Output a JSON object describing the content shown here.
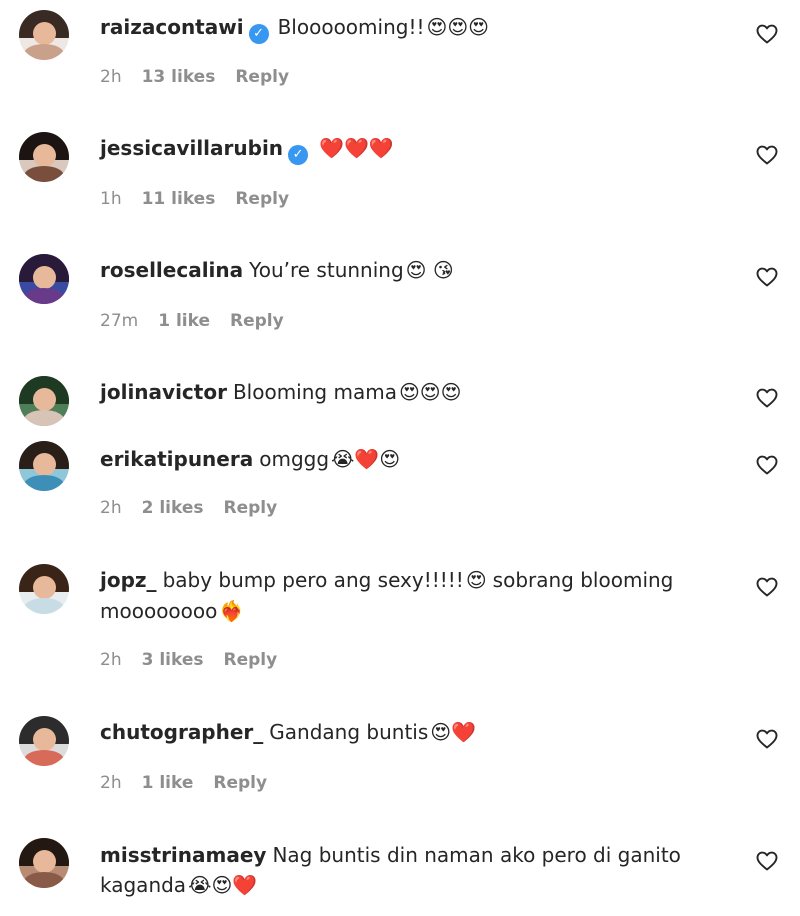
{
  "comments": [
    {
      "username": "raizacontawi",
      "verified": true,
      "text": "Bloooooming!!",
      "emojis": "😍😍😍",
      "text2": "",
      "emojis2": "",
      "time": "2h",
      "likes": "13 likes",
      "reply": "Reply",
      "avatar": {
        "hair": "#3a2a24",
        "body": "#c9a08a",
        "bg": "#efe7e2"
      }
    },
    {
      "username": "jessicavillarubin",
      "verified": true,
      "text": "",
      "emojis": "❤️❤️❤️",
      "text2": "",
      "emojis2": "",
      "time": "1h",
      "likes": "11 likes",
      "reply": "Reply",
      "avatar": {
        "hair": "#1c1412",
        "body": "#7a4e3c",
        "bg": "#d9c8be"
      }
    },
    {
      "username": "rosellecalina",
      "verified": false,
      "text": "You’re stunning",
      "emojis": "😍 😘",
      "text2": "",
      "emojis2": "",
      "time": "27m",
      "likes": "1 like",
      "reply": "Reply",
      "avatar": {
        "hair": "#2a1a3a",
        "body": "#6a3a8a",
        "bg": "#3a4aa0"
      }
    },
    {
      "username": "jolinavictor",
      "verified": false,
      "text": "Blooming mama",
      "emojis": "😍😍😍",
      "text2": "",
      "emojis2": "",
      "time": "",
      "likes": "",
      "reply": "",
      "avatar": {
        "hair": "#1f3a22",
        "body": "#d8c4b6",
        "bg": "#4f7f58"
      }
    },
    {
      "username": "erikatipunera",
      "verified": false,
      "text": "omggg",
      "emojis": "😭❤️😍",
      "text2": "",
      "emojis2": "",
      "time": "2h",
      "likes": "2 likes",
      "reply": "Reply",
      "avatar": {
        "hair": "#2a1e18",
        "body": "#3d8fb8",
        "bg": "#8fc7d8"
      }
    },
    {
      "username": "jopz_",
      "verified": false,
      "text": "baby bump pero ang sexy!!!!!",
      "emojis": "😍",
      "text2": "sobrang blooming",
      "emojis2": "",
      "text3": "moooooooo",
      "emojis3": "❤️‍🔥",
      "time": "2h",
      "likes": "3 likes",
      "reply": "Reply",
      "avatar": {
        "hair": "#3a2418",
        "body": "#c8dce6",
        "bg": "#e8eef0"
      }
    },
    {
      "username": "chutographer_",
      "verified": false,
      "text": "Gandang buntis",
      "emojis": "😍❤️",
      "text2": "",
      "emojis2": "",
      "time": "2h",
      "likes": "1 like",
      "reply": "Reply",
      "avatar": {
        "hair": "#2c2c2c",
        "body": "#d86a5a",
        "bg": "#dcdcdc"
      }
    },
    {
      "username": "misstrinamaey",
      "verified": false,
      "text": "Nag buntis din naman ako pero di ganito",
      "emojis": "",
      "text2": "",
      "emojis2": "",
      "text3": "kaganda",
      "emojis3": "😭😍❤️",
      "time": "",
      "likes": "",
      "reply": "",
      "avatar": {
        "hair": "#241812",
        "body": "#8a5a48",
        "bg": "#b88b74"
      }
    }
  ],
  "icons": {
    "like": "heart-outline-icon",
    "verified": "verified-badge-icon"
  }
}
